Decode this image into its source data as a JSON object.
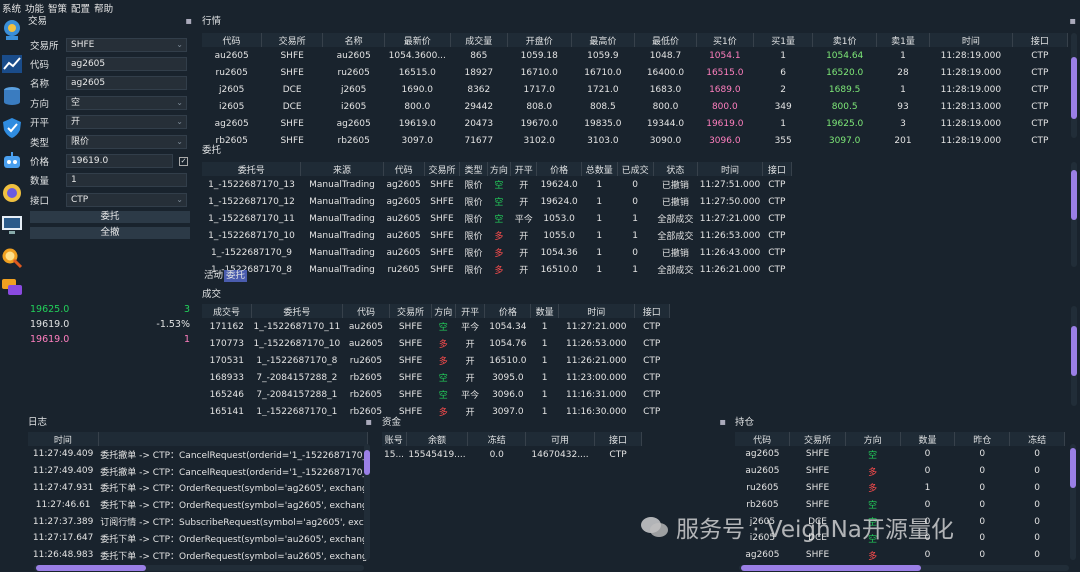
{
  "menu": [
    "系统",
    "功能",
    "智策",
    "配置",
    "帮助"
  ],
  "trade_panel": {
    "title": "交易",
    "labels": [
      "交易所",
      "代码",
      "名称",
      "方向",
      "开平",
      "类型",
      "价格",
      "数量",
      "接口"
    ],
    "exchange": "SHFE",
    "symbol": "ag2605",
    "name": "ag2605",
    "direction": "空",
    "offset": "开",
    "order_type": "限价",
    "price": "19619.0",
    "volume": "1",
    "gateway": "CTP",
    "send_btn": "委托",
    "cancel_all_btn": "全撤",
    "depth": [
      {
        "price": "19625.0",
        "value": "3",
        "cls": "green"
      },
      {
        "price": "19619.0",
        "value": "-1.53%",
        "cls": ""
      },
      {
        "price": "19619.0",
        "value": "1",
        "cls": "pink"
      }
    ]
  },
  "tick": {
    "title": "行情",
    "headers": [
      "代码",
      "交易所",
      "名称",
      "最新价",
      "成交量",
      "开盘价",
      "最高价",
      "最低价",
      "买1价",
      "买1量",
      "卖1价",
      "卖1量",
      "时间",
      "接口"
    ],
    "rows": [
      [
        "au2605",
        "SHFE",
        "au2605",
        "1054.3600...",
        "865",
        "1059.18",
        "1059.9",
        "1048.7",
        "1054.1",
        "1",
        "1054.64",
        "1",
        "11:28:19.000",
        "CTP"
      ],
      [
        "ru2605",
        "SHFE",
        "ru2605",
        "16515.0",
        "18927",
        "16710.0",
        "16710.0",
        "16400.0",
        "16515.0",
        "6",
        "16520.0",
        "28",
        "11:28:19.000",
        "CTP"
      ],
      [
        "j2605",
        "DCE",
        "j2605",
        "1690.0",
        "8362",
        "1717.0",
        "1721.0",
        "1683.0",
        "1689.0",
        "2",
        "1689.5",
        "1",
        "11:28:19.000",
        "CTP"
      ],
      [
        "i2605",
        "DCE",
        "i2605",
        "800.0",
        "29442",
        "808.0",
        "808.5",
        "800.0",
        "800.0",
        "349",
        "800.5",
        "93",
        "11:28:13.000",
        "CTP"
      ],
      [
        "ag2605",
        "SHFE",
        "ag2605",
        "19619.0",
        "20473",
        "19670.0",
        "19835.0",
        "19344.0",
        "19619.0",
        "1",
        "19625.0",
        "3",
        "11:28:19.000",
        "CTP"
      ],
      [
        "rb2605",
        "SHFE",
        "rb2605",
        "3097.0",
        "71677",
        "3102.0",
        "3103.0",
        "3090.0",
        "3096.0",
        "355",
        "3097.0",
        "201",
        "11:28:19.000",
        "CTP"
      ]
    ]
  },
  "orders": {
    "title": "委托",
    "headers": [
      "委托号",
      "来源",
      "代码",
      "交易所",
      "类型",
      "方向",
      "开平",
      "价格",
      "总数量",
      "已成交",
      "状态",
      "时间",
      "接口"
    ],
    "rows": [
      [
        "1_-1522687170_13",
        "ManualTrading",
        "ag2605",
        "SHFE",
        "限价",
        "空",
        "开",
        "19624.0",
        "1",
        "0",
        "已撤销",
        "11:27:51.000",
        "CTP"
      ],
      [
        "1_-1522687170_12",
        "ManualTrading",
        "ag2605",
        "SHFE",
        "限价",
        "空",
        "开",
        "19624.0",
        "1",
        "0",
        "已撤销",
        "11:27:50.000",
        "CTP"
      ],
      [
        "1_-1522687170_11",
        "ManualTrading",
        "au2605",
        "SHFE",
        "限价",
        "空",
        "平今",
        "1053.0",
        "1",
        "1",
        "全部成交",
        "11:27:21.000",
        "CTP"
      ],
      [
        "1_-1522687170_10",
        "ManualTrading",
        "au2605",
        "SHFE",
        "限价",
        "多",
        "开",
        "1055.0",
        "1",
        "1",
        "全部成交",
        "11:26:53.000",
        "CTP"
      ],
      [
        "1_-1522687170_9",
        "ManualTrading",
        "au2605",
        "SHFE",
        "限价",
        "多",
        "开",
        "1054.36",
        "1",
        "0",
        "已撤销",
        "11:26:43.000",
        "CTP"
      ],
      [
        "1_-1522687170_8",
        "ManualTrading",
        "ru2605",
        "SHFE",
        "限价",
        "多",
        "开",
        "16510.0",
        "1",
        "1",
        "全部成交",
        "11:26:21.000",
        "CTP"
      ]
    ],
    "tabs": [
      "活动",
      "委托"
    ]
  },
  "trades": {
    "title": "成交",
    "headers": [
      "成交号",
      "委托号",
      "代码",
      "交易所",
      "方向",
      "开平",
      "价格",
      "数量",
      "时间",
      "接口"
    ],
    "rows": [
      [
        "171162",
        "1_-1522687170_11",
        "au2605",
        "SHFE",
        "空",
        "平今",
        "1054.34",
        "1",
        "11:27:21.000",
        "CTP"
      ],
      [
        "170773",
        "1_-1522687170_10",
        "au2605",
        "SHFE",
        "多",
        "开",
        "1054.76",
        "1",
        "11:26:53.000",
        "CTP"
      ],
      [
        "170531",
        "1_-1522687170_8",
        "ru2605",
        "SHFE",
        "多",
        "开",
        "16510.0",
        "1",
        "11:26:21.000",
        "CTP"
      ],
      [
        "168933",
        "7_-2084157288_2",
        "rb2605",
        "SHFE",
        "空",
        "开",
        "3095.0",
        "1",
        "11:23:00.000",
        "CTP"
      ],
      [
        "165246",
        "7_-2084157288_1",
        "rb2605",
        "SHFE",
        "空",
        "平今",
        "3096.0",
        "1",
        "11:16:31.000",
        "CTP"
      ],
      [
        "165141",
        "1_-1522687170_1",
        "rb2605",
        "SHFE",
        "多",
        "开",
        "3097.0",
        "1",
        "11:16:30.000",
        "CTP"
      ]
    ]
  },
  "log": {
    "title": "日志",
    "header": "时间",
    "rows": [
      [
        "11:27:49.409",
        "委托撤单 -> CTP：CancelRequest(orderid='1_-1522687170_13', s"
      ],
      [
        "11:27:49.409",
        "委托撤单 -> CTP：CancelRequest(orderid='1_-1522687170_12', s"
      ],
      [
        "11:27:47.931",
        "委托下单 -> CTP：OrderRequest(symbol='ag2605', exchange=<Ex"
      ],
      [
        "11:27:46.61",
        "委托下单 -> CTP：OrderRequest(symbol='ag2605', exchange=<Ex"
      ],
      [
        "11:27:37.389",
        "订阅行情 -> CTP：SubscribeRequest(symbol='ag2605', exchange="
      ],
      [
        "11:27:17.647",
        "委托下单 -> CTP：OrderRequest(symbol='au2605', exchange=<Ex"
      ],
      [
        "11:26:48.983",
        "委托下单 -> CTP：OrderRequest(symbol='au2605', exchange=<Ex"
      ]
    ]
  },
  "account": {
    "title": "资金",
    "headers": [
      "账号",
      "余额",
      "冻结",
      "可用",
      "接口"
    ],
    "rows": [
      [
        "15...",
        "15545419....",
        "0.0",
        "14670432....",
        "CTP"
      ]
    ]
  },
  "position": {
    "title": "持仓",
    "headers": [
      "代码",
      "交易所",
      "方向",
      "数量",
      "昨仓",
      "冻结"
    ],
    "rows": [
      [
        "ag2605",
        "SHFE",
        "空",
        "0",
        "0",
        "0"
      ],
      [
        "au2605",
        "SHFE",
        "多",
        "0",
        "0",
        "0"
      ],
      [
        "ru2605",
        "SHFE",
        "多",
        "1",
        "0",
        "0"
      ],
      [
        "rb2605",
        "SHFE",
        "空",
        "0",
        "0",
        "0"
      ],
      [
        "j2605",
        "DCE",
        "空",
        "0",
        "0",
        "0"
      ],
      [
        "i2605",
        "DCE",
        "空",
        "0",
        "0",
        "0"
      ],
      [
        "ag2605",
        "SHFE",
        "多",
        "0",
        "0",
        "0"
      ]
    ]
  },
  "watermark": "服务号 · VeighNa开源量化"
}
